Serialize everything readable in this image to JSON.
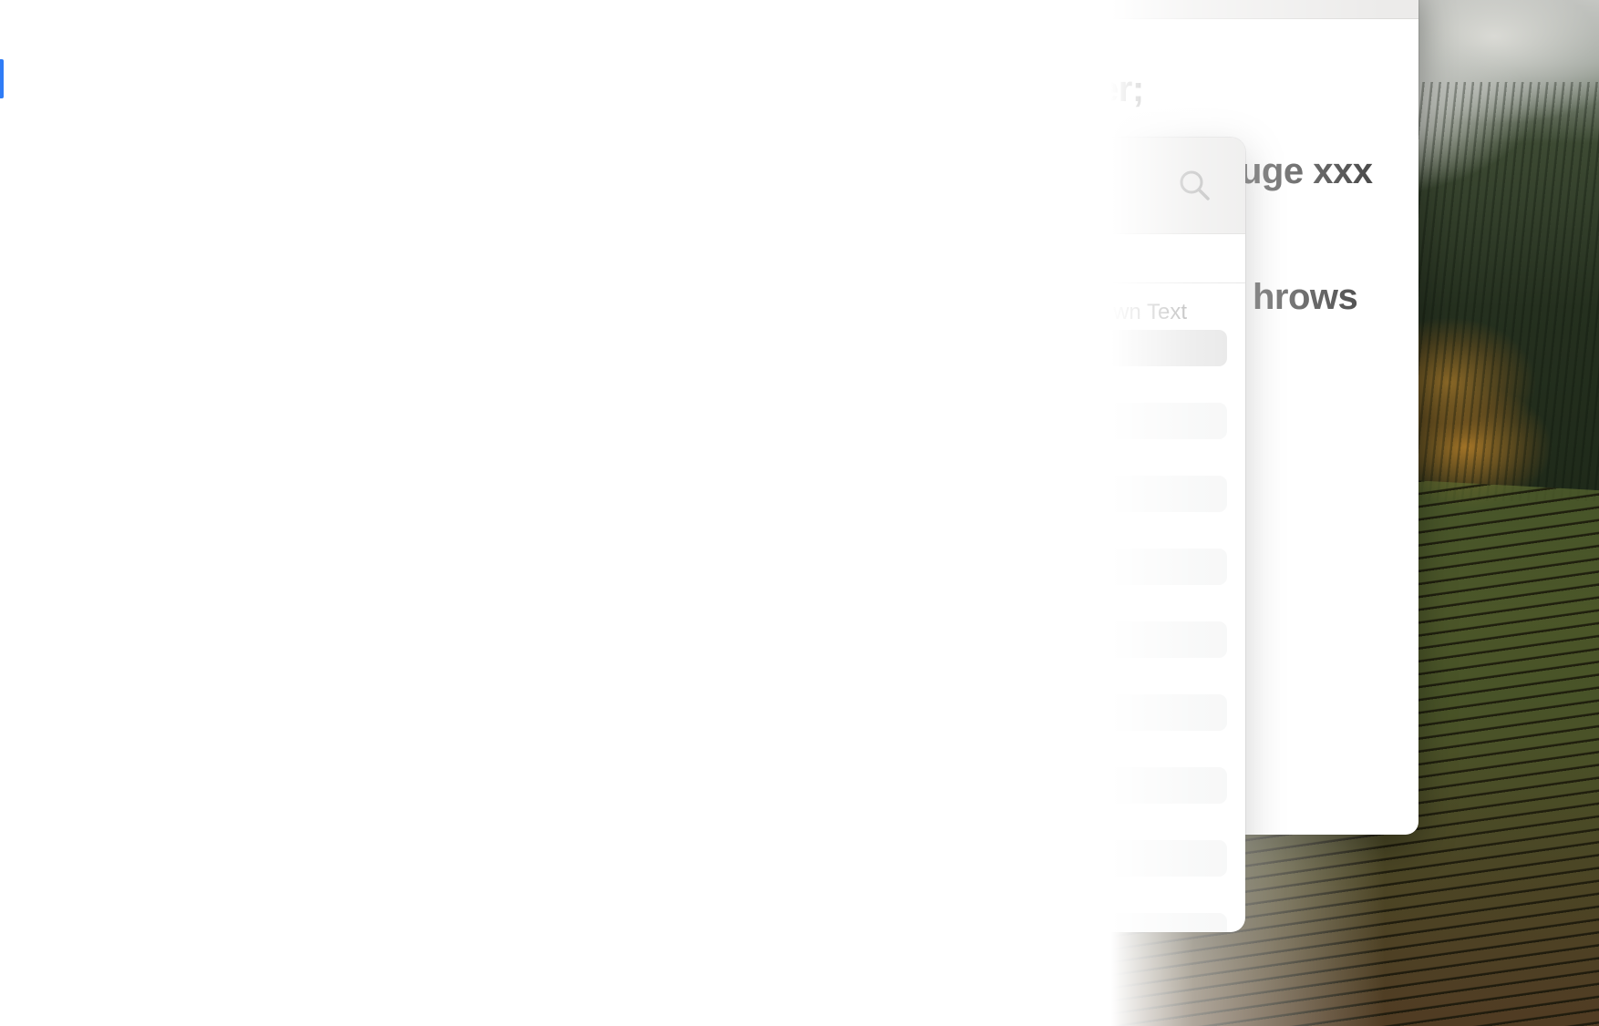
{
  "desktop": {
    "wallpaper": "vineyard-hillside-with-fog"
  },
  "document_window": {
    "lines": [
      "er;",
      "uge xxx",
      "hrows"
    ]
  },
  "list_panel": {
    "search_icon": "search-icon",
    "section_label": "wn Text",
    "rows": [
      {
        "label": "",
        "selected": true
      },
      {
        "label": "",
        "selected": false
      },
      {
        "label": "",
        "selected": false
      },
      {
        "label": "",
        "selected": false
      },
      {
        "label": "",
        "selected": false
      },
      {
        "label": "",
        "selected": false
      },
      {
        "label": "",
        "selected": false
      },
      {
        "label": "",
        "selected": false
      },
      {
        "label": "",
        "selected": false
      }
    ]
  },
  "editor": {
    "cursor_color": "#2f7cf6"
  },
  "colors": {
    "panel_header": "#e6e5e4",
    "row_fill": "#f1f2f2",
    "row_selected": "#d9d9d9",
    "doc_text": "#444444"
  }
}
